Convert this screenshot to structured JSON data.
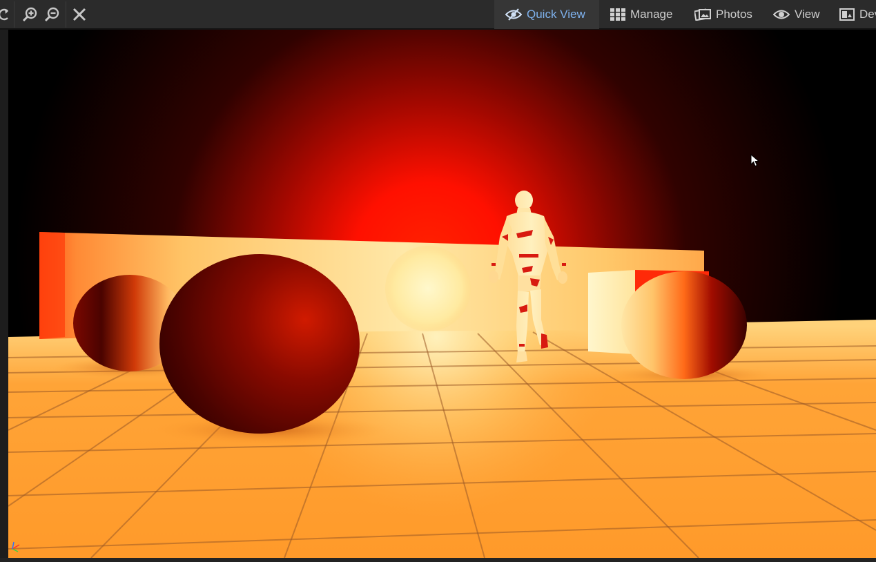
{
  "toolbar": {
    "icons": [
      "refresh-icon",
      "zoom-in-icon",
      "zoom-out-icon",
      "close-icon"
    ],
    "tabs": [
      {
        "label": "Quick View",
        "icon": "eye-slash-icon",
        "active": true
      },
      {
        "label": "Manage",
        "icon": "grid-icon",
        "active": false
      },
      {
        "label": "Photos",
        "icon": "photos-icon",
        "active": false
      },
      {
        "label": "View",
        "icon": "eye-icon",
        "active": false
      },
      {
        "label": "Deve",
        "icon": "develop-icon",
        "active": false
      }
    ]
  },
  "colors": {
    "toolbar_bg": "#2b2b2b",
    "active_tab_bg": "#363636",
    "active_tab_text": "#7fb2ee",
    "tab_text": "#cfcfcf",
    "floor": "#ff9d2e",
    "glow": "#ff1a00"
  },
  "viewport": {
    "scene": "rendered-3d-scene",
    "objects": [
      "sphere-left",
      "sphere-center",
      "sphere-right",
      "back-wall",
      "box",
      "mannequin",
      "floor-grid"
    ]
  }
}
